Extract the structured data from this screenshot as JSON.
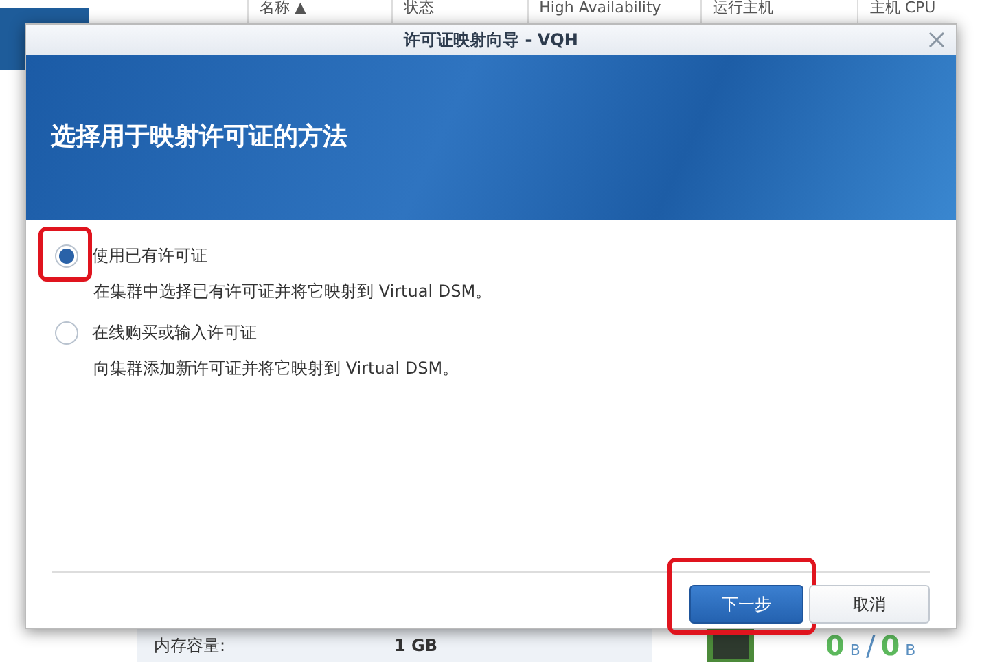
{
  "background": {
    "table_columns": [
      "名称 ▲",
      "状态",
      "High Availability",
      "运行主机",
      "主机 CPU"
    ],
    "memory_label": "内存容量:",
    "memory_value": "1 GB",
    "traffic": [
      {
        "value": "0",
        "unit": "B"
      },
      {
        "value": "0",
        "unit": "B"
      }
    ],
    "traffic_separator": "/"
  },
  "dialog": {
    "title": "许可证映射向导 - VQH",
    "heading": "选择用于映射许可证的方法",
    "options": [
      {
        "label": "使用已有许可证",
        "description": "在集群中选择已有许可证并将它映射到 Virtual DSM。",
        "selected": true,
        "highlighted": true
      },
      {
        "label": "在线购买或输入许可证",
        "description": "向集群添加新许可证并将它映射到 Virtual DSM。",
        "selected": false,
        "highlighted": false
      }
    ],
    "buttons": [
      {
        "label": "下一步",
        "kind": "primary",
        "highlighted": true
      },
      {
        "label": "取消",
        "kind": "default",
        "highlighted": false
      }
    ]
  }
}
